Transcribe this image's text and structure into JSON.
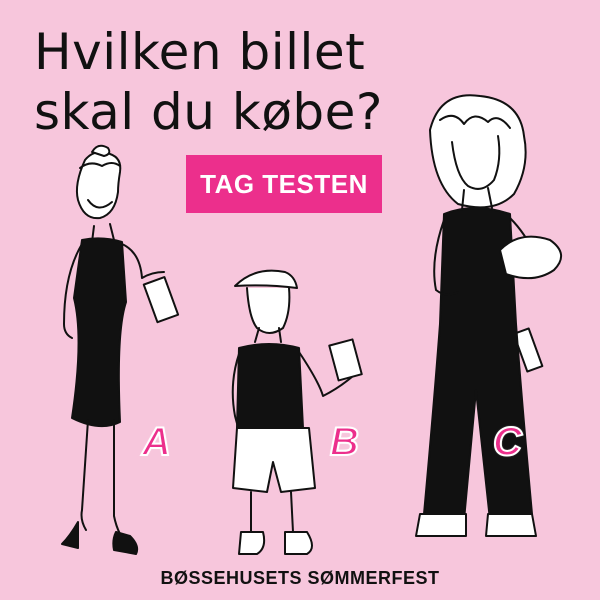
{
  "headline": {
    "line1": "Hvilken billet",
    "line2": "skal du købe?"
  },
  "cta": {
    "label": "TAG TESTEN",
    "color": "#ec2f8c"
  },
  "options": [
    {
      "letter": "A"
    },
    {
      "letter": "B"
    },
    {
      "letter": "C"
    }
  ],
  "footer": {
    "brand": "BØSSEHUSETS SØMMERFEST"
  },
  "colors": {
    "background": "#f7c6dc",
    "accent": "#ec2f8c",
    "ink": "#111111"
  }
}
